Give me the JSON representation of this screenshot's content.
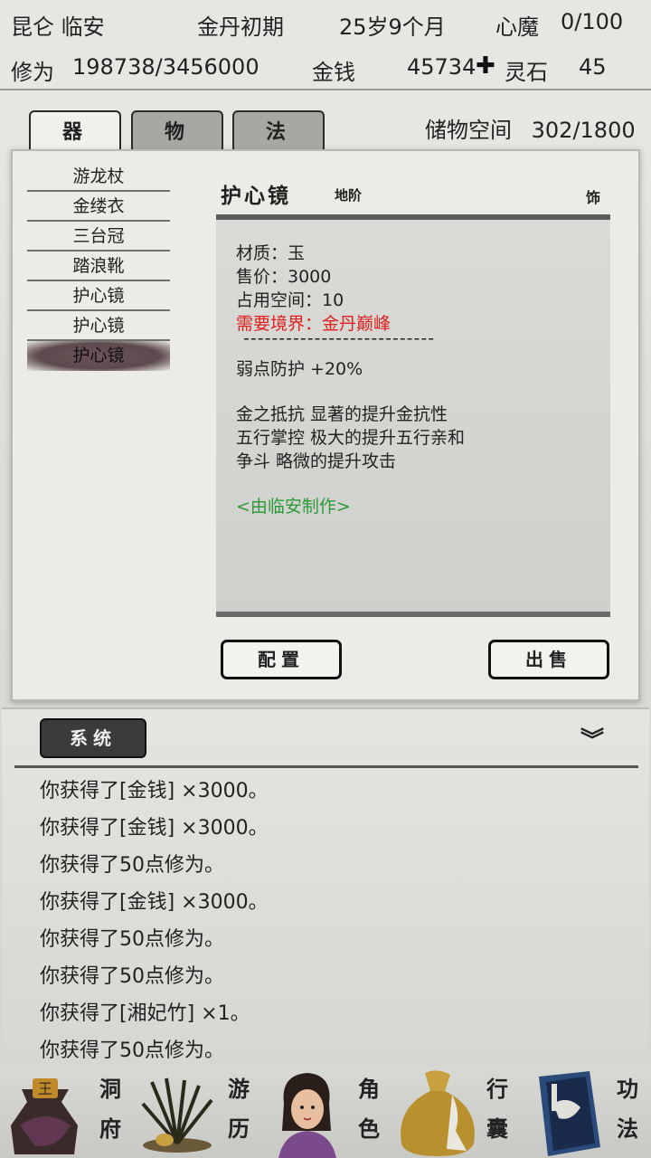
{
  "header": {
    "location": "昆仑 临安",
    "realm": "金丹初期",
    "age": "25岁9个月",
    "heart_demon_label": "心魔",
    "heart_demon_value": "0/100",
    "cultivation_label": "修为",
    "cultivation_value": "198738/3456000",
    "money_label": "金钱",
    "money_value": "45734",
    "spirit_stone_label": "灵石",
    "spirit_stone_value": "45"
  },
  "tabs": [
    {
      "label": "器",
      "active": true
    },
    {
      "label": "物",
      "active": false
    },
    {
      "label": "法",
      "active": false
    }
  ],
  "storage": {
    "label": "储物空间",
    "value": "302/1800"
  },
  "items": [
    {
      "name": "游龙杖"
    },
    {
      "name": "金缕衣"
    },
    {
      "name": "三台冠"
    },
    {
      "name": "踏浪靴"
    },
    {
      "name": "护心镜"
    },
    {
      "name": "护心镜"
    },
    {
      "name": "护心镜",
      "selected": true
    }
  ],
  "detail": {
    "title": "护心镜",
    "tier": "地阶",
    "slot": "饰",
    "material": "材质：玉",
    "price": "售价：3000",
    "space": "占用空间：10",
    "requirement": "需要境界：金丹巅峰",
    "separator": "---------------------------",
    "attribute": "弱点防护 +20%",
    "effects": [
      "金之抵抗 显著的提升金抗性",
      "五行掌控 极大的提升五行亲和",
      "争斗 略微的提升攻击"
    ],
    "crafted_by": "<由临安制作>"
  },
  "buttons": {
    "equip": "配置",
    "sell": "出售"
  },
  "log": {
    "channel": "系统",
    "lines": [
      "你获得了[金钱] ×3000。",
      "你获得了[金钱] ×3000。",
      "你获得了50点修为。",
      "你获得了[金钱] ×3000。",
      "你获得了50点修为。",
      "你获得了50点修为。",
      "你获得了[湘妃竹] ×1。",
      "你获得了50点修为。"
    ]
  },
  "nav": [
    {
      "label1": "洞",
      "label2": "府",
      "icon": "cave-bag-icon"
    },
    {
      "label1": "游",
      "label2": "历",
      "icon": "grass-icon"
    },
    {
      "label1": "角",
      "label2": "色",
      "icon": "character-portrait-icon"
    },
    {
      "label1": "行",
      "label2": "囊",
      "icon": "pouch-icon"
    },
    {
      "label1": "功",
      "label2": "法",
      "icon": "book-icon"
    }
  ],
  "colors": {
    "requirement": "#e02020",
    "crafted": "#2a9a3a"
  }
}
